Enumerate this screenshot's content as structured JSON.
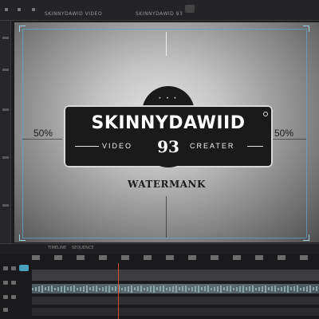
{
  "tabs": [
    {
      "label": "SKINNYDAWID VIDEO"
    },
    {
      "label": "SKINNYDAWID 93"
    }
  ],
  "canvas": {
    "left_percent_label": "50%",
    "right_percent_label": "50%",
    "watermark_text": "WATERMANK"
  },
  "logo": {
    "brand": "SKINNYDAWIID",
    "sub_left": "VIDEO",
    "sub_right": "CREATER",
    "badge_number": "93",
    "dots": "• • •"
  },
  "timeline": {
    "labels": [
      "TIMELINE",
      "SEQUENCE"
    ]
  }
}
